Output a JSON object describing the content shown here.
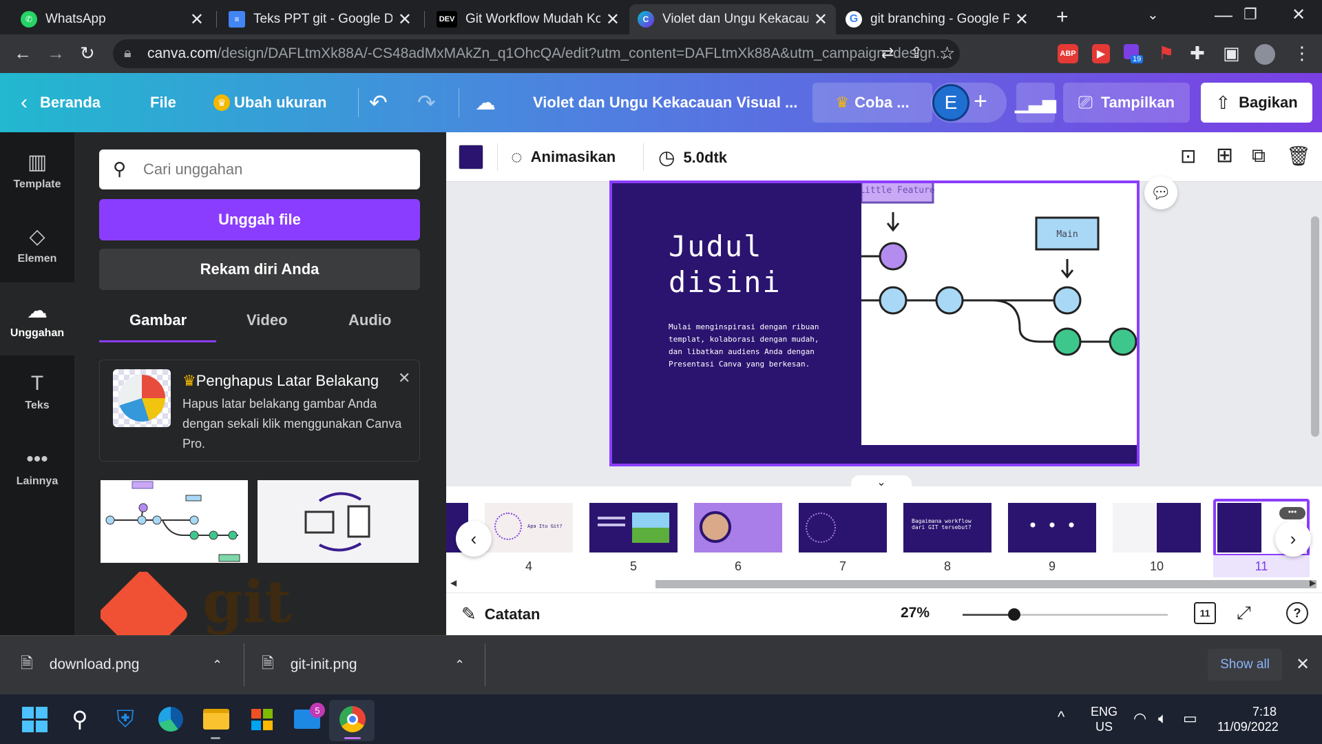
{
  "browser": {
    "tabs": [
      {
        "title": "WhatsApp",
        "icon": "whatsapp-icon",
        "color": "#25d366"
      },
      {
        "title": "Teks PPT git - Google Dok",
        "icon": "google-docs-icon",
        "color": "#4285f4"
      },
      {
        "title": "Git Workflow Mudah Kok!",
        "icon": "dev-icon",
        "color": "#000000"
      },
      {
        "title": "Violet dan Ungu Kekacaua",
        "icon": "canva-icon",
        "color": "#7b3fe4"
      },
      {
        "title": "git branching - Google Pe",
        "icon": "google-icon",
        "color": "#ffffff"
      }
    ],
    "url_host": "canva.com",
    "url_path": "/design/DAFLtmXk88A/-CS48adMxMAkZn_q1OhcQA/edit?utm_content=DAFLtmXk88A&utm_campaign=design...",
    "ext_badge": "19"
  },
  "canva": {
    "home": "Beranda",
    "file": "File",
    "resize": "Ubah ukuran",
    "doc_title": "Violet dan Ungu Kekacauan Visual ...",
    "try_pro": "Coba ...",
    "avatar": "E",
    "present": "Tampilkan",
    "share": "Bagikan"
  },
  "rail": {
    "items": [
      {
        "label": "Template",
        "icon": "template-icon",
        "glyph": "▥"
      },
      {
        "label": "Elemen",
        "icon": "elements-icon",
        "glyph": "◇"
      },
      {
        "label": "Unggahan",
        "icon": "upload-icon",
        "glyph": "☁"
      },
      {
        "label": "Teks",
        "icon": "text-icon",
        "glyph": "T"
      },
      {
        "label": "Lainnya",
        "icon": "more-icon",
        "glyph": "•••"
      }
    ]
  },
  "panel": {
    "search_placeholder": "Cari unggahan",
    "upload_label": "Unggah file",
    "record_label": "Rekam diri Anda",
    "tabs": [
      "Gambar",
      "Video",
      "Audio"
    ],
    "promo_title": "Penghapus Latar Belakang",
    "promo_body": "Hapus latar belakang gambar Anda dengan sekali klik menggunakan Canva Pro."
  },
  "editor": {
    "animate": "Animasikan",
    "duration": "5.0dtk",
    "notes": "Catatan",
    "zoom": "27%",
    "page_count": "11"
  },
  "slide": {
    "title_line1": "Judul",
    "title_line2": "disini",
    "body": "Mulai menginspirasi dengan ribuan templat, kolaborasi dengan mudah, dan libatkan audiens Anda dengan Presentasi Canva yang berkesan.",
    "label_feature": "Little Feature",
    "label_main": "Main"
  },
  "thumbnails": {
    "numbers": [
      "4",
      "5",
      "6",
      "7",
      "8",
      "9",
      "10",
      "11"
    ],
    "thumb4_text": "Apa Itu Git?",
    "thumb8_text": "Bagaimana workflow dari GIT tersebut?"
  },
  "downloads": {
    "items": [
      "download.png",
      "git-init.png"
    ],
    "show_all": "Show all"
  },
  "taskbar": {
    "lang1": "ENG",
    "lang2": "US",
    "time": "7:18",
    "date": "11/09/2022",
    "mail_badge": "5"
  }
}
